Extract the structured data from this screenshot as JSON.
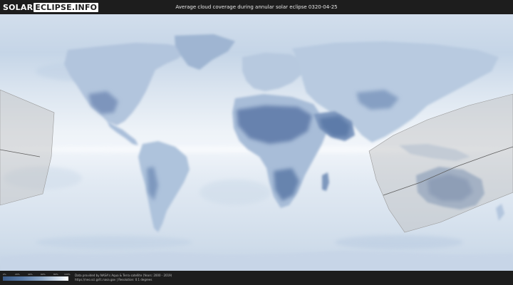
{
  "header": {
    "logo_solar": "SOLAR",
    "logo_eclipse": "ECLIPSE.INFO",
    "title": "Average cloud coverage during annular solar eclipse 0320-04-25"
  },
  "legend": {
    "labels": [
      "0%",
      "20%",
      "40%",
      "60%",
      "80%",
      "100%"
    ]
  },
  "attribution": {
    "line1": "Data provided by NASA's Aqua & Terra satellite (Years: 2000 - 2019)",
    "line2": "https://neo.sci.gsfc.nasa.gov | Resolution: 0.1 degrees"
  },
  "colors": {
    "background": "#1d1d1d",
    "ocean_cloud": "#e4ecf4",
    "clear_sky": "#5573a2",
    "eclipse_path": "#bcbcbc"
  }
}
